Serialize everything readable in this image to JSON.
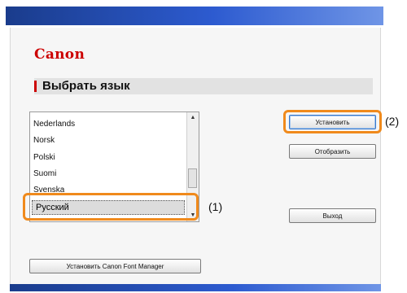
{
  "app": {
    "logo": "Canon",
    "heading": "Выбрать язык"
  },
  "languages": {
    "items": [
      "Nederlands",
      "Norsk",
      "Polski",
      "Suomi",
      "Svenska"
    ],
    "selected": "Русский"
  },
  "buttons": {
    "install": "Установить",
    "display": "Отобразить",
    "exit": "Выход",
    "install_font_manager": "Установить Canon Font Manager"
  },
  "callouts": {
    "one": "(1)",
    "two": "(2)"
  },
  "colors": {
    "highlight": "#f08a1c",
    "brand": "#cc0000",
    "titlebar": "#2d5bd0"
  }
}
